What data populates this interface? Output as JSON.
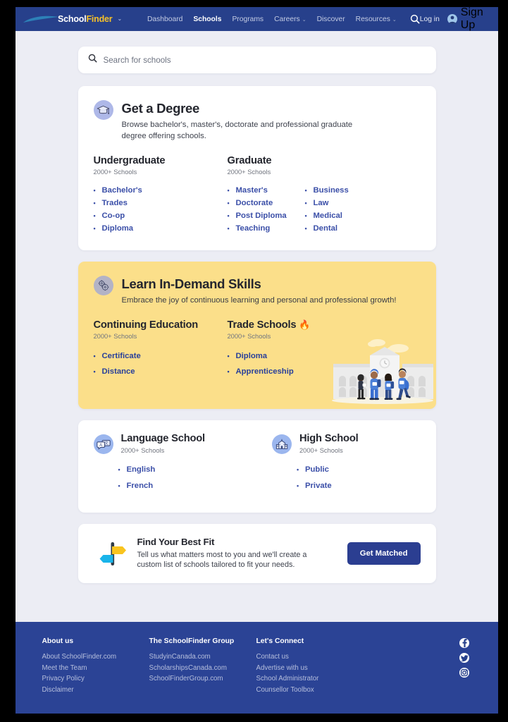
{
  "header": {
    "brand": {
      "part1": "School",
      "part2": "Finder",
      "caret": "⌄"
    },
    "nav": [
      {
        "label": "Dashboard",
        "active": false,
        "caret": ""
      },
      {
        "label": "Schools",
        "active": true,
        "caret": ""
      },
      {
        "label": "Programs",
        "active": false,
        "caret": ""
      },
      {
        "label": "Careers",
        "active": false,
        "caret": "⌄"
      },
      {
        "label": "Discover",
        "active": false,
        "caret": ""
      },
      {
        "label": "Resources",
        "active": false,
        "caret": "⌄"
      }
    ],
    "search_icon": "search-icon",
    "login_label": "Log in",
    "signup_label": "Sign Up"
  },
  "search": {
    "placeholder": "Search for schools",
    "value": ""
  },
  "degree_card": {
    "title": "Get a Degree",
    "description": "Browse bachelor's, master's, doctorate and professional graduate degree offering schools.",
    "icon": "graduation-cap-icon",
    "undergraduate": {
      "title": "Undergraduate",
      "count": "2000+ Schools",
      "links": [
        "Bachelor's",
        "Trades",
        "Co-op",
        "Diploma"
      ]
    },
    "graduate": {
      "title": "Graduate",
      "count": "2000+ Schools",
      "links_col1": [
        "Master's",
        "Doctorate",
        "Post Diploma",
        "Teaching"
      ],
      "links_col2": [
        "Business",
        "Law",
        "Medical",
        "Dental"
      ]
    }
  },
  "skills_card": {
    "title": "Learn In-Demand Skills",
    "description": "Embrace the joy of continuous learning and personal and professional growth!",
    "icon": "gears-icon",
    "continuing": {
      "title": "Continuing Education",
      "count": "2000+ Schools",
      "links": [
        "Certificate",
        "Distance"
      ]
    },
    "trade": {
      "title": "Trade Schools",
      "badge": "🔥",
      "count": "2000+ Schools",
      "links": [
        "Diploma",
        "Apprenticeship"
      ]
    },
    "illustration": "school-building-students-illustration"
  },
  "schools_card": {
    "language": {
      "title": "Language School",
      "count": "2000+ Schools",
      "icon": "translate-speech-bubbles-icon",
      "links": [
        "English",
        "French"
      ]
    },
    "high": {
      "title": "High School",
      "count": "2000+ Schools",
      "icon": "school-building-icon",
      "links": [
        "Public",
        "Private"
      ]
    }
  },
  "bestfit_card": {
    "icon": "signpost-icon",
    "title": "Find Your Best Fit",
    "description": "Tell us what matters most to you and we'll create a custom list of schools tailored to fit your needs.",
    "button_label": "Get Matched"
  },
  "footer": {
    "columns": [
      {
        "title": "About us",
        "links": [
          "About SchoolFinder.com",
          "Meet the Team",
          "Privacy Policy",
          "Disclaimer"
        ]
      },
      {
        "title": "The SchoolFinder Group",
        "links": [
          "StudyinCanada.com",
          "ScholarshipsCanada.com",
          "SchoolFinderGroup.com"
        ]
      },
      {
        "title": "Let's Connect",
        "links": [
          "Contact us",
          "Advertise with us",
          "School Administrator",
          "Counsellor Toolbox"
        ]
      }
    ],
    "socials": [
      "facebook-icon",
      "twitter-icon",
      "instagram-icon"
    ]
  },
  "colors": {
    "navy": "#27408b",
    "footer_navy": "#2b4395",
    "accent_yellow": "#fbdf8a",
    "link_blue": "#3b4fa8",
    "button_navy": "#2b3e91",
    "page_bg": "#ecedf4",
    "brand_yellow": "#f7c128"
  }
}
